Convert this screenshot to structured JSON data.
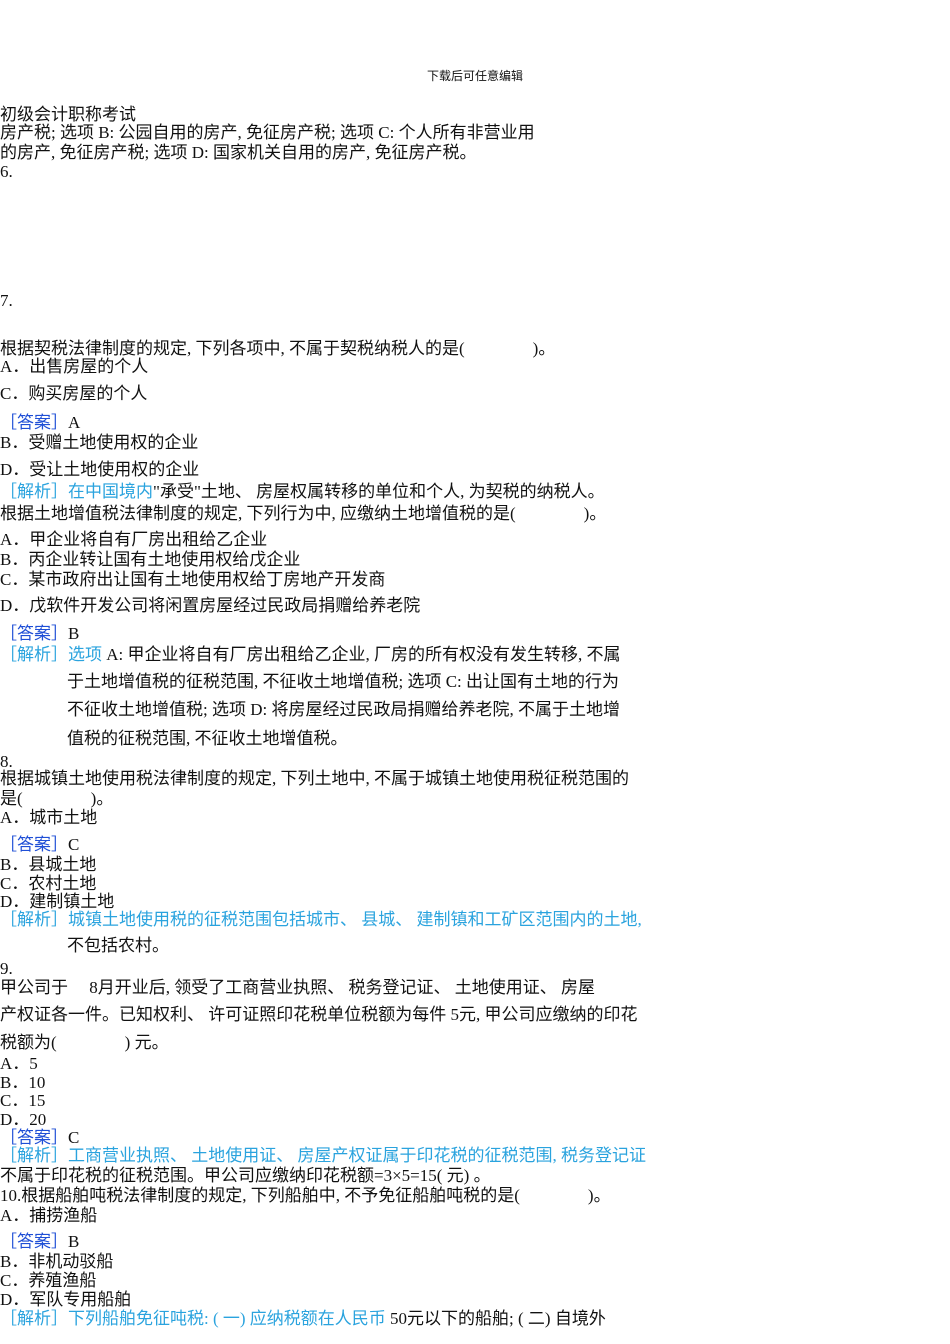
{
  "header": "下载后可任意编辑",
  "lines": {
    "l1": "初级会计职称考试",
    "l2": "房产税; 选项 B: 公园自用的房产, 免征房产税; 选项 C: 个人所有非营业用",
    "l3": "的房产, 免征房产税; 选项 D: 国家机关自用的房产, 免征房产税。",
    "n6": "6.",
    "n7": "7.",
    "q7": "根据契税法律制度的规定, 下列各项中, 不属于契税纳税人的是(　　　　)。",
    "q7a": "A．出售房屋的个人",
    "q7c": "C．购买房屋的个人",
    "q7ans_tag": "［答案］",
    "q7ans": "A",
    "q7b": "B．受赠土地使用权的企业",
    "q7d": "D．受让土地使用权的企业",
    "q7exp_tag": "［解析］",
    "q7exp_blue": "在中国境内",
    "q7exp": "\"承受\"土地、 房屋权属转移的单位和个人, 为契税的纳税人。",
    "q7b2": "根据土地增值税法律制度的规定, 下列行为中, 应缴纳土地增值税的是(　　　　)。",
    "q7b2a": "A．甲企业将自有厂房出租给乙企业",
    "q7b2b": "B．丙企业转让国有土地使用权给戊企业",
    "q7b2c": "C．某市政府出让国有土地使用权给丁房地产开发商",
    "q7b2d": "D．戊软件开发公司将闲置房屋经过民政局捐赠给养老院",
    "q7b2ans_tag": "［答案］",
    "q7b2ans": "B",
    "q7b2exp_tag": "［解析］",
    "q7b2exp_blue": "选项",
    "q7b2exp1": " A: 甲企业将自有厂房出租给乙企业, 厂房的所有权没有发生转移, 不属",
    "q7b2exp2": "于土地增值税的征税范围, 不征收土地增值税; 选项 C: 出让国有土地的行为",
    "q7b2exp3": "不征收土地增值税; 选项 D: 将房屋经过民政局捐赠给养老院, 不属于土地增",
    "q7b2exp4": "值税的征税范围, 不征收土地增值税。",
    "n8": "8.",
    "q8_1": "根据城镇土地使用税法律制度的规定, 下列土地中, 不属于城镇土地使用税征税范围的",
    "q8_2": "是(　　　　)。",
    "q8a": "A．城市土地",
    "q8ans_tag": "［答案］",
    "q8ans": "C",
    "q8b": "B．县城土地",
    "q8c": "C．农村土地",
    "q8d": "D．建制镇土地",
    "q8exp_tag": "［解析］",
    "q8exp1": "城镇土地使用税的征税范围包括城市、 县城、 建制镇和工矿区范围内的土地,",
    "q8exp2": "不包括农村。",
    "n9": "9.",
    "q9_1": "甲公司于　 8月开业后, 领受了工商营业执照、 税务登记证、 土地使用证、 房屋",
    "q9_2": "产权证各一件。已知权利、 许可证照印花税单位税额为每件 5元, 甲公司应缴纳的印花",
    "q9_3": "税额为(　　　　) 元。",
    "q9a": "A．5",
    "q9b": "B．10",
    "q9c": "C．15",
    "q9d": "D．20",
    "q9ans_tag": "［答案］",
    "q9ans": "C",
    "q9exp_tag": "［解析］",
    "q9exp1": "工商营业执照、 土地使用证、 房屋产权证属于印花税的征税范围, 税务登记证",
    "q9exp2": "不属于印花税的征税范围。甲公司应缴纳印花税额=3×5=15( 元) 。",
    "q10": "10.根据船舶吨税法律制度的规定, 下列船舶中, 不予免征船舶吨税的是(　　　　)。",
    "q10a": "A．捕捞渔船",
    "q10ans_tag": "［答案］",
    "q10ans": "B",
    "q10b": "B．非机动驳船",
    "q10c": "C．养殖渔船",
    "q10d": "D．军队专用船舶",
    "q10exp_tag": "［解析］",
    "q10exp_blue": "下列船舶免征吨税: ( 一) 应纳税额在人民币",
    "q10exp": " 50元以下的船舶; ( 二) 自境外"
  }
}
